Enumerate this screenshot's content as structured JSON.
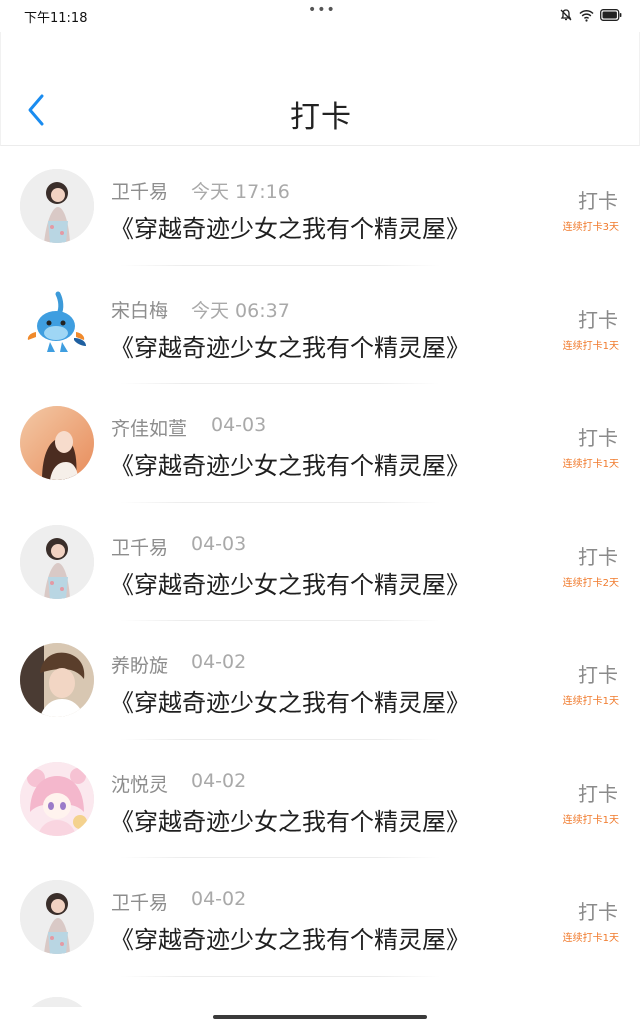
{
  "status_bar": {
    "time": "下午11:18",
    "dots": "•••",
    "icons": [
      "mute-icon",
      "wifi-icon",
      "battery-icon"
    ]
  },
  "header": {
    "title": "打卡",
    "back_icon": "chevron-left-icon",
    "accent": "#1a8cf0"
  },
  "colors": {
    "name": "#8d8d8d",
    "time": "#a9a9a9",
    "book": "#1f1f1f",
    "checkin": "#8a8a8a",
    "streak": "#f07a2c"
  },
  "rows": [
    {
      "name": "卫千易",
      "time": "今天 17:16",
      "book": "《穿越奇迹少女之我有个精灵屋》",
      "action": "打卡",
      "streak": "连续打卡3天",
      "avatar": "woman-photo-avatar"
    },
    {
      "name": "宋白梅",
      "time": "今天 06:37",
      "book": "《穿越奇迹少女之我有个精灵屋》",
      "action": "打卡",
      "streak": "连续打卡1天",
      "avatar": "mudkip-avatar"
    },
    {
      "name": "齐佳如萱",
      "time": "04-03",
      "book": "《穿越奇迹少女之我有个精灵屋》",
      "action": "打卡",
      "streak": "连续打卡1天",
      "avatar": "girl-photo-avatar"
    },
    {
      "name": "卫千易",
      "time": "04-03",
      "book": "《穿越奇迹少女之我有个精灵屋》",
      "action": "打卡",
      "streak": "连续打卡2天",
      "avatar": "woman-photo-avatar"
    },
    {
      "name": "养盼旋",
      "time": "04-02",
      "book": "《穿越奇迹少女之我有个精灵屋》",
      "action": "打卡",
      "streak": "连续打卡1天",
      "avatar": "man-photo-avatar"
    },
    {
      "name": "沈悦灵",
      "time": "04-02",
      "book": "《穿越奇迹少女之我有个精灵屋》",
      "action": "打卡",
      "streak": "连续打卡1天",
      "avatar": "anime-girl-avatar"
    },
    {
      "name": "卫千易",
      "time": "04-02",
      "book": "《穿越奇迹少女之我有个精灵屋》",
      "action": "打卡",
      "streak": "连续打卡1天",
      "avatar": "woman-photo-avatar"
    }
  ]
}
